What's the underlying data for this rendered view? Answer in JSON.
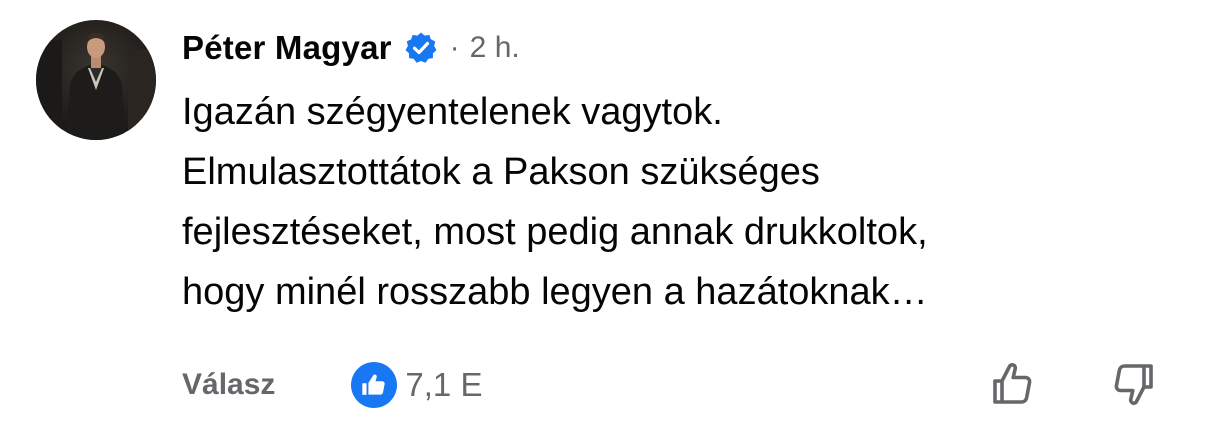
{
  "comment": {
    "author": "Péter Magyar",
    "verified_icon": "verified-badge-icon",
    "separator": "·",
    "time": "2 h.",
    "text_lines": [
      "Igazán szégyentelenek vagytok.",
      "Elmulasztottátok a Pakson szükséges",
      "fejlesztéseket, most pedig annak drukkoltok,",
      "hogy minél rosszabb legyen a hazátoknak…"
    ]
  },
  "actions": {
    "reply_label": "Válasz",
    "reaction_icon": "like-icon",
    "reaction_count": "7,1 E",
    "upvote_icon": "thumbs-up-outline-icon",
    "downvote_icon": "thumbs-down-outline-icon"
  },
  "colors": {
    "accent": "#1877f2",
    "secondary_text": "#65676b",
    "primary_text": "#050505"
  }
}
